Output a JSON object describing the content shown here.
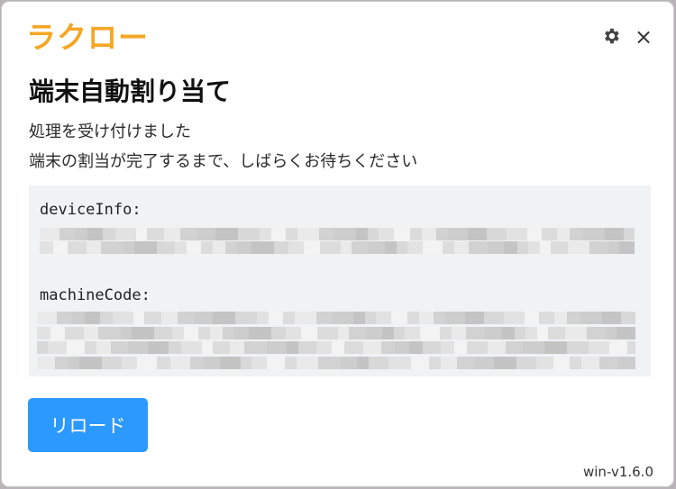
{
  "app": {
    "logo_text": "ラクロー",
    "logo_color": "#f5a623"
  },
  "header": {
    "settings_icon": "gear-icon",
    "close_icon": "close-icon",
    "close_glyph": "×"
  },
  "main": {
    "title": "端末自動割り当て",
    "message_line1": "処理を受け付けました",
    "message_line2": "端末の割当が完了するまで、しばらくお待ちください",
    "device_info_label": "deviceInfo:",
    "machine_code_label": "machineCode:",
    "reload_button": "リロード"
  },
  "footer": {
    "version": "win-v1.6.0"
  },
  "colors": {
    "accent": "#2c99ff",
    "panel": "#f1f2f4"
  }
}
